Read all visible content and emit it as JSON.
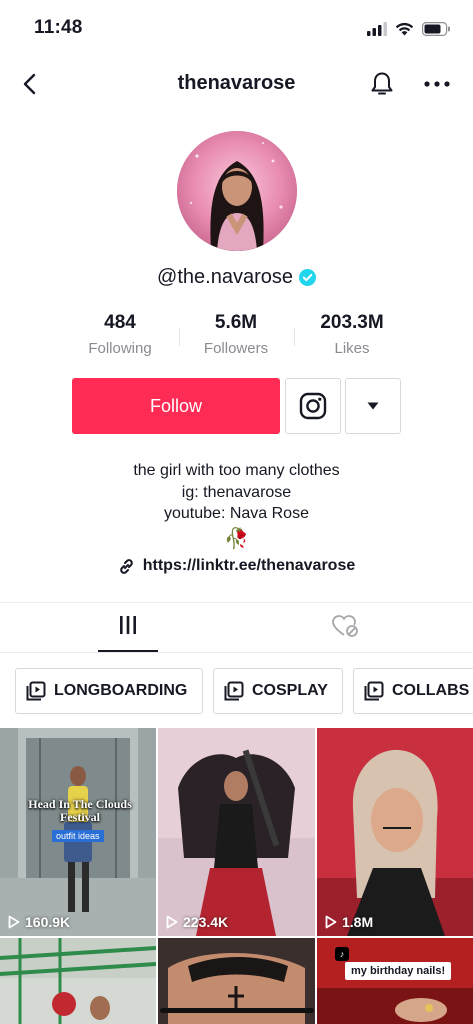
{
  "status_bar": {
    "time": "11:48"
  },
  "nav": {
    "title": "thenavarose"
  },
  "profile": {
    "handle": "@the.navarose",
    "verified": true,
    "accent_color": "#20d5ec"
  },
  "stats": [
    {
      "value": "484",
      "label": "Following"
    },
    {
      "value": "5.6M",
      "label": "Followers"
    },
    {
      "value": "203.3M",
      "label": "Likes"
    }
  ],
  "actions": {
    "follow_label": "Follow",
    "follow_color": "#fe2c55",
    "instagram_icon": "instagram-icon",
    "dropdown_icon": "caret-down-icon"
  },
  "bio": {
    "line1": "the girl with too many clothes",
    "line2": "ig: thenavarose",
    "line3": "youtube: Nava Rose",
    "line4": "🥀",
    "link": "https://linktr.ee/thenavarose"
  },
  "tabs": {
    "active": "videos",
    "icons": [
      "grid-icon",
      "liked-hidden-icon"
    ]
  },
  "playlists": [
    {
      "label": "LONGBOARDING"
    },
    {
      "label": "COSPLAY"
    },
    {
      "label": "COLLABS"
    }
  ],
  "videos": [
    {
      "views": "160.9K",
      "overlay_title": "Head In The Clouds Festival",
      "overlay_chip": "outfit ideas"
    },
    {
      "views": "223.4K"
    },
    {
      "views": "1.8M"
    },
    {
      "views": ""
    },
    {
      "views": ""
    },
    {
      "views": "",
      "overlay_chip": "my birthday nails!"
    }
  ]
}
